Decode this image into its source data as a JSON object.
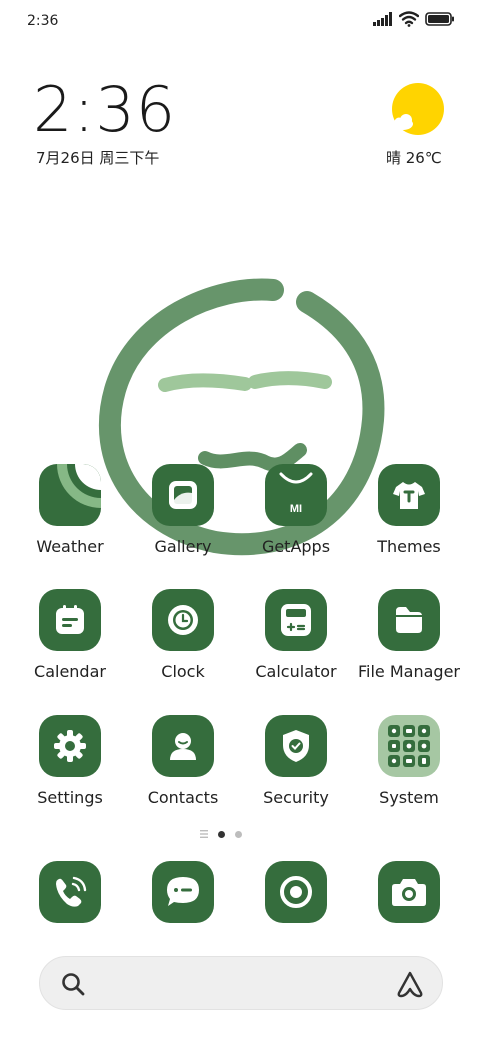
{
  "status_bar": {
    "time": "2:36",
    "icons": [
      "signal-icon",
      "wifi-icon",
      "battery-icon"
    ]
  },
  "clock_widget": {
    "time": "2:36",
    "date": "7月26日 周三下午"
  },
  "weather_widget": {
    "condition_temp": "晴 26℃",
    "icon": "sun-cloud-icon"
  },
  "apps": [
    {
      "label": "Weather",
      "icon": "weather-icon"
    },
    {
      "label": "Gallery",
      "icon": "gallery-icon"
    },
    {
      "label": "GetApps",
      "icon": "getapps-bag-icon"
    },
    {
      "label": "Themes",
      "icon": "tshirt-icon"
    },
    {
      "label": "Calendar",
      "icon": "calendar-icon"
    },
    {
      "label": "Clock",
      "icon": "clock-icon"
    },
    {
      "label": "Calculator",
      "icon": "calculator-icon"
    },
    {
      "label": "File Manager",
      "icon": "folder-icon"
    },
    {
      "label": "Settings",
      "icon": "gear-icon"
    },
    {
      "label": "Contacts",
      "icon": "person-icon"
    },
    {
      "label": "Security",
      "icon": "shield-icon"
    },
    {
      "label": "System",
      "icon": "app-folder-icon"
    }
  ],
  "getapps_badge": "MI",
  "dock": [
    {
      "icon": "phone-icon"
    },
    {
      "icon": "message-icon"
    },
    {
      "icon": "browser-icon"
    },
    {
      "icon": "camera-icon"
    }
  ],
  "page_indicator": {
    "pages": 2,
    "current": 1
  },
  "colors": {
    "accent": "#356d3d",
    "accent_light": "#86b886",
    "sun": "#ffd400"
  }
}
